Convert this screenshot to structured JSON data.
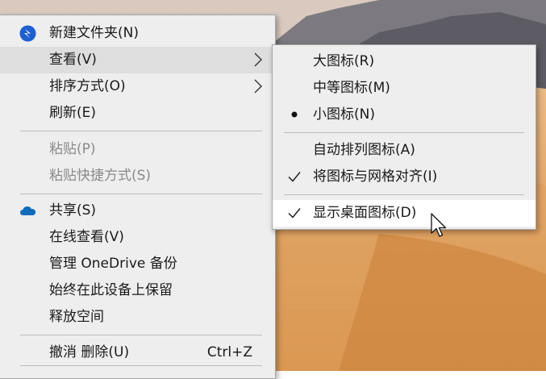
{
  "context_menu": {
    "items": [
      {
        "label": "新建文件夹(N)",
        "icon": "new-folder-icon"
      },
      {
        "label": "查看(V)",
        "submenu_arrow": "chevron-right-icon"
      },
      {
        "label": "排序方式(O)",
        "submenu_arrow": "chevron-right-icon"
      },
      {
        "label": "刷新(E)"
      },
      {
        "label": "粘贴(P)",
        "disabled": true
      },
      {
        "label": "粘贴快捷方式(S)",
        "disabled": true
      },
      {
        "label": "共享(S)",
        "icon": "onedrive-cloud-icon"
      },
      {
        "label": "在线查看(V)"
      },
      {
        "label": "管理 OneDrive 备份"
      },
      {
        "label": "始终在此设备上保留"
      },
      {
        "label": "释放空间"
      },
      {
        "label": "撤消 删除(U)",
        "shortcut": "Ctrl+Z"
      }
    ]
  },
  "view_submenu": {
    "items": [
      {
        "label": "大图标(R)"
      },
      {
        "label": "中等图标(M)"
      },
      {
        "label": "小图标(N)",
        "indicator": "radio-dot-icon"
      },
      {
        "label": "自动排列图标(A)"
      },
      {
        "label": "将图标与网格对齐(I)",
        "indicator": "checkmark-icon"
      },
      {
        "label": "显示桌面图标(D)",
        "indicator": "checkmark-icon"
      }
    ]
  },
  "colors": {
    "menu_background": "#eeeeee",
    "hover_background": "#dedede",
    "active_background": "#ffffff",
    "disabled_text": "#8a8a8a",
    "onedrive_blue": "#0f6cbd"
  }
}
